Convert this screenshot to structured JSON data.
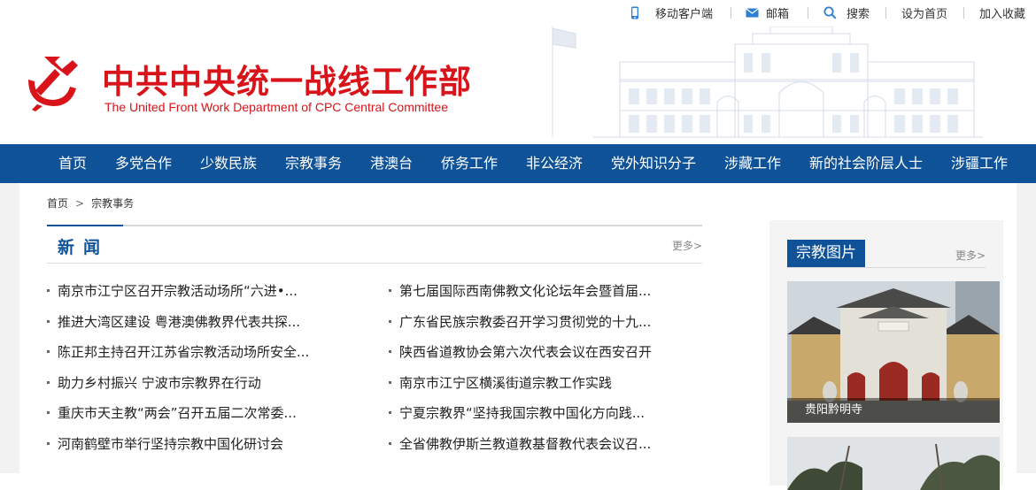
{
  "topbar": {
    "mobile": "移动客户端",
    "mail": "邮箱",
    "search": "搜索",
    "homepage": "设为首页",
    "favorite": "加入收藏"
  },
  "header": {
    "title_cn": "中共中央统一战线工作部",
    "title_en": "The United Front Work Department of CPC Central Committee",
    "emblem_icon": "party-emblem-icon"
  },
  "nav": {
    "items": [
      "首页",
      "多党合作",
      "少数民族",
      "宗教事务",
      "港澳台",
      "侨务工作",
      "非公经济",
      "党外知识分子",
      "涉藏工作",
      "新的社会阶层人士",
      "涉疆工作"
    ]
  },
  "breadcrumb": {
    "home": "首页",
    "arrow": ">",
    "current": "宗教事务"
  },
  "news": {
    "title": "新闻",
    "more": "更多>",
    "left": [
      "南京市江宁区召开宗教活动场所“六进•...",
      "推进大湾区建设 粤港澳佛教界代表共探...",
      "陈正邦主持召开江苏省宗教活动场所安全...",
      "助力乡村振兴 宁波市宗教界在行动",
      "重庆市天主教“两会”召开五届二次常委...",
      "河南鹤壁市举行坚持宗教中国化研讨会"
    ],
    "right": [
      "第七届国际西南佛教文化论坛年会暨首届...",
      "广东省民族宗教委召开学习贯彻党的十九...",
      "陕西省道教协会第六次代表会议在西安召开",
      "南京市江宁区横溪街道宗教工作实践",
      "宁夏宗教界“坚持我国宗教中国化方向践...",
      "全省佛教伊斯兰教道教基督教代表会议召..."
    ]
  },
  "photos": {
    "title": "宗教图片",
    "more": "更多>",
    "items": [
      {
        "caption": "贵阳黔明寺"
      }
    ]
  },
  "colors": {
    "brand_red": "#d8131a",
    "nav_blue": "#0f5297"
  }
}
